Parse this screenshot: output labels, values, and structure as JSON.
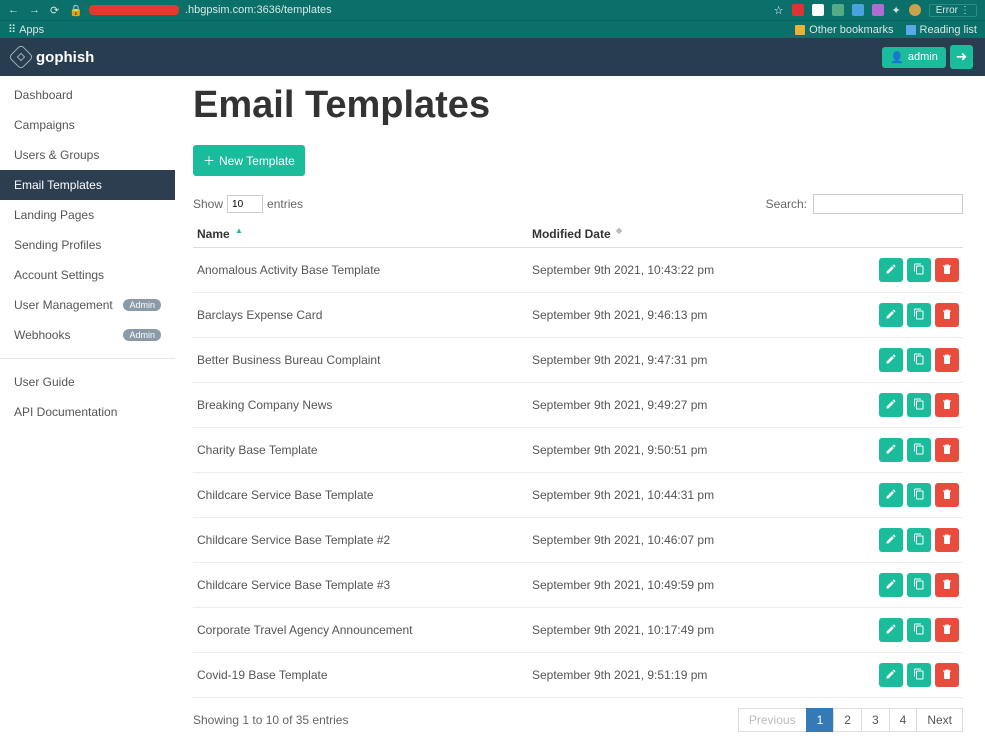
{
  "browser": {
    "url_suffix": ".hbgpsim.com:3636/templates",
    "apps_label": "Apps",
    "other_bookmarks": "Other bookmarks",
    "reading_list": "Reading list",
    "error_label": "Error"
  },
  "topbar": {
    "brand": "gophish",
    "admin_label": "admin"
  },
  "sidebar": {
    "items": [
      {
        "label": "Dashboard"
      },
      {
        "label": "Campaigns"
      },
      {
        "label": "Users & Groups"
      },
      {
        "label": "Email Templates"
      },
      {
        "label": "Landing Pages"
      },
      {
        "label": "Sending Profiles"
      },
      {
        "label": "Account Settings"
      },
      {
        "label": "User Management",
        "admin": true
      },
      {
        "label": "Webhooks",
        "admin": true
      }
    ],
    "active_index": 3,
    "admin_badge": "Admin",
    "secondary": [
      {
        "label": "User Guide"
      },
      {
        "label": "API Documentation"
      }
    ]
  },
  "page": {
    "title": "Email Templates",
    "new_button": "New Template",
    "show_label": "Show",
    "entries_label": "entries",
    "length_value": "10",
    "search_label": "Search:",
    "columns": {
      "name": "Name",
      "date": "Modified Date"
    },
    "rows": [
      {
        "name": "Anomalous Activity Base Template",
        "date": "September 9th 2021, 10:43:22 pm"
      },
      {
        "name": "Barclays Expense Card",
        "date": "September 9th 2021, 9:46:13 pm"
      },
      {
        "name": "Better Business Bureau Complaint",
        "date": "September 9th 2021, 9:47:31 pm"
      },
      {
        "name": "Breaking Company News",
        "date": "September 9th 2021, 9:49:27 pm"
      },
      {
        "name": "Charity Base Template",
        "date": "September 9th 2021, 9:50:51 pm"
      },
      {
        "name": "Childcare Service Base Template",
        "date": "September 9th 2021, 10:44:31 pm"
      },
      {
        "name": "Childcare Service Base Template #2",
        "date": "September 9th 2021, 10:46:07 pm"
      },
      {
        "name": "Childcare Service Base Template #3",
        "date": "September 9th 2021, 10:49:59 pm"
      },
      {
        "name": "Corporate Travel Agency Announcement",
        "date": "September 9th 2021, 10:17:49 pm"
      },
      {
        "name": "Covid-19 Base Template",
        "date": "September 9th 2021, 9:51:19 pm"
      }
    ],
    "info_text": "Showing 1 to 10 of 35 entries",
    "pagination": {
      "prev": "Previous",
      "pages": [
        "1",
        "2",
        "3",
        "4"
      ],
      "active": 0,
      "next": "Next"
    }
  }
}
